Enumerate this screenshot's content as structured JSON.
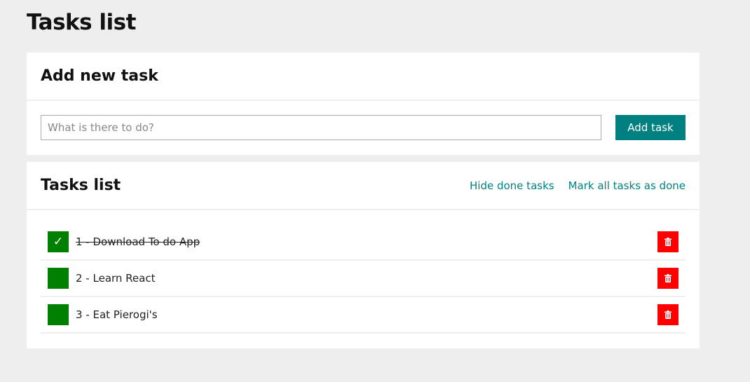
{
  "page": {
    "title": "Tasks list"
  },
  "add_section": {
    "heading": "Add new task",
    "input_placeholder": "What is there to do?",
    "input_value": "",
    "add_label": "Add task"
  },
  "list_section": {
    "heading": "Tasks list",
    "hide_done_label": "Hide done tasks",
    "mark_all_label": "Mark all tasks as done",
    "tasks": [
      {
        "text": "1 - Download To do App",
        "done": true,
        "toggle_icon": "check-icon",
        "remove_icon": "trash-icon"
      },
      {
        "text": "2 - Learn React",
        "done": false,
        "toggle_icon": "",
        "remove_icon": "trash-icon"
      },
      {
        "text": "3 - Eat Pierogi's",
        "done": false,
        "toggle_icon": "",
        "remove_icon": "trash-icon"
      }
    ]
  },
  "colors": {
    "accent": "#008080",
    "toggle": "#008000",
    "remove": "#ff0000",
    "background": "#eeeeee"
  }
}
